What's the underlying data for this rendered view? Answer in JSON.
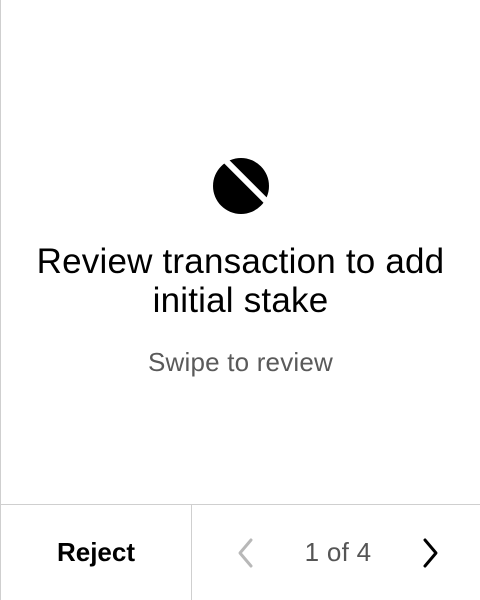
{
  "main": {
    "logo_icon": "ontology-logo-icon",
    "title": "Review transaction to add initial stake",
    "subtitle": "Swipe to review"
  },
  "footer": {
    "reject_label": "Reject",
    "page_indicator": "1 of 4",
    "previous_icon": "chevron-left-icon",
    "next_icon": "chevron-right-icon"
  },
  "colors": {
    "text": "#000000",
    "secondary_text": "#5a5a5a",
    "disabled_icon": "#b8b8b8",
    "divider": "#cfcfcf",
    "background": "#ffffff"
  }
}
